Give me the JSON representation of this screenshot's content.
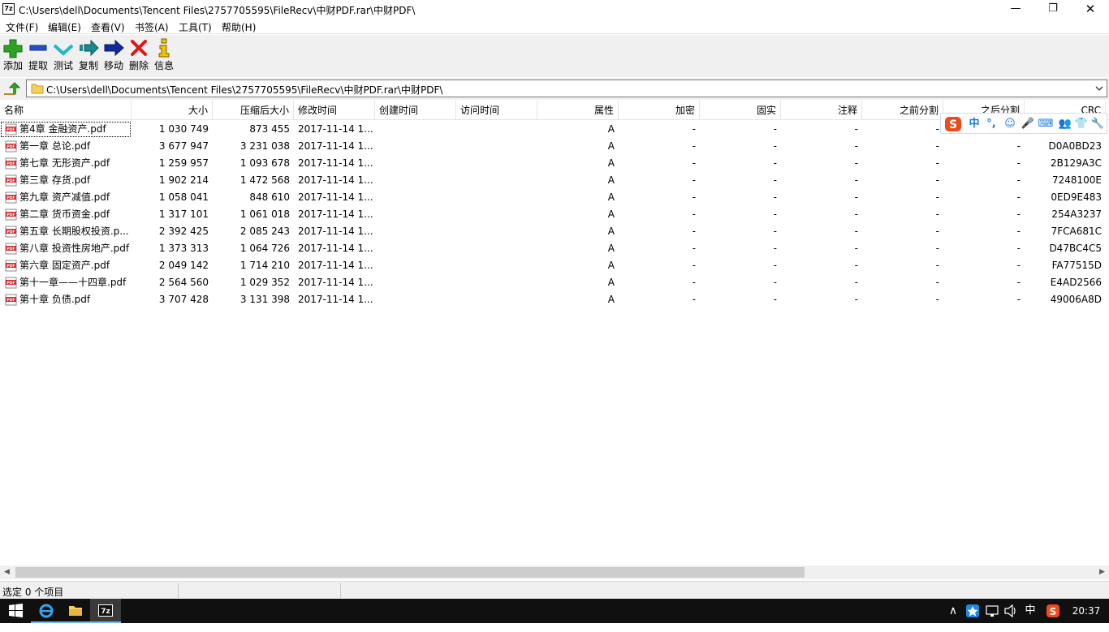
{
  "window": {
    "app_icon_text": "7z",
    "title": "C:\\Users\\dell\\Documents\\Tencent Files\\2757705595\\FileRecv\\中财PDF.rar\\中财PDF\\",
    "minimize": "—",
    "maximize": "❐",
    "close": "✕"
  },
  "menu": {
    "file": "文件(F)",
    "edit": "编辑(E)",
    "view": "查看(V)",
    "bookmarks": "书签(A)",
    "tools": "工具(T)",
    "help": "帮助(H)"
  },
  "toolbar": {
    "add": "添加",
    "extract": "提取",
    "test": "测试",
    "copy": "复制",
    "move": "移动",
    "delete": "删除",
    "info": "信息"
  },
  "address": {
    "path": "C:\\Users\\dell\\Documents\\Tencent Files\\2757705595\\FileRecv\\中财PDF.rar\\中财PDF\\"
  },
  "columns": {
    "name": "名称",
    "size": "大小",
    "packed": "压缩后大小",
    "modified": "修改时间",
    "created": "创建时间",
    "accessed": "访问时间",
    "attributes": "属性",
    "encrypted": "加密",
    "solid": "固实",
    "comment": "注释",
    "split_before": "之前分割",
    "split_after": "之后分割",
    "crc": "CRC"
  },
  "files": [
    {
      "name": "第4章 金融资产.pdf",
      "size": "1 030 749",
      "packed": "873 455",
      "modified": "2017-11-14 1...",
      "attr": "A",
      "enc": "-",
      "solid": "-",
      "comment": "-",
      "before": "-",
      "after": "",
      "crc": ""
    },
    {
      "name": "第一章  总论.pdf",
      "size": "3 677 947",
      "packed": "3 231 038",
      "modified": "2017-11-14 1...",
      "attr": "A",
      "enc": "-",
      "solid": "-",
      "comment": "-",
      "before": "-",
      "after": "-",
      "crc": "D0A0BD23"
    },
    {
      "name": "第七章  无形资产.pdf",
      "size": "1 259 957",
      "packed": "1 093 678",
      "modified": "2017-11-14 1...",
      "attr": "A",
      "enc": "-",
      "solid": "-",
      "comment": "-",
      "before": "-",
      "after": "-",
      "crc": "2B129A3C"
    },
    {
      "name": "第三章  存货.pdf",
      "size": "1 902 214",
      "packed": "1 472 568",
      "modified": "2017-11-14 1...",
      "attr": "A",
      "enc": "-",
      "solid": "-",
      "comment": "-",
      "before": "-",
      "after": "-",
      "crc": "7248100E"
    },
    {
      "name": "第九章    资产减值.pdf",
      "size": "1 058 041",
      "packed": "848 610",
      "modified": "2017-11-14 1...",
      "attr": "A",
      "enc": "-",
      "solid": "-",
      "comment": "-",
      "before": "-",
      "after": "-",
      "crc": "0ED9E483"
    },
    {
      "name": "第二章  货币资金.pdf",
      "size": "1 317 101",
      "packed": "1 061 018",
      "modified": "2017-11-14 1...",
      "attr": "A",
      "enc": "-",
      "solid": "-",
      "comment": "-",
      "before": "-",
      "after": "-",
      "crc": "254A3237"
    },
    {
      "name": "第五章  长期股权投资.p...",
      "size": "2 392 425",
      "packed": "2 085 243",
      "modified": "2017-11-14 1...",
      "attr": "A",
      "enc": "-",
      "solid": "-",
      "comment": "-",
      "before": "-",
      "after": "-",
      "crc": "7FCA681C"
    },
    {
      "name": "第八章 投资性房地产.pdf",
      "size": "1 373 313",
      "packed": "1 064 726",
      "modified": "2017-11-14 1...",
      "attr": "A",
      "enc": "-",
      "solid": "-",
      "comment": "-",
      "before": "-",
      "after": "-",
      "crc": "D47BC4C5"
    },
    {
      "name": "第六章  固定资产.pdf",
      "size": "2 049 142",
      "packed": "1 714 210",
      "modified": "2017-11-14 1...",
      "attr": "A",
      "enc": "-",
      "solid": "-",
      "comment": "-",
      "before": "-",
      "after": "-",
      "crc": "FA77515D"
    },
    {
      "name": "第十一章——十四章.pdf",
      "size": "2 564 560",
      "packed": "1 029 352",
      "modified": "2017-11-14 1...",
      "attr": "A",
      "enc": "-",
      "solid": "-",
      "comment": "-",
      "before": "-",
      "after": "-",
      "crc": "E4AD2566"
    },
    {
      "name": "第十章  负债.pdf",
      "size": "3 707 428",
      "packed": "3 131 398",
      "modified": "2017-11-14 1...",
      "attr": "A",
      "enc": "-",
      "solid": "-",
      "comment": "-",
      "before": "-",
      "after": "-",
      "crc": "49006A8D"
    }
  ],
  "status": {
    "selection": "选定 0 个项目"
  },
  "ime": {
    "logo": "S",
    "mode": "中",
    "punct": "°,",
    "emoji": "☺",
    "voice": "🎤",
    "keyboard": "⌨",
    "user": "👥",
    "skin": "👕",
    "tools": "🔧"
  },
  "taskbar": {
    "tray_up": "∧",
    "lang": "中",
    "clock": "20:37"
  },
  "colors": {
    "pdf_red": "#d8262c",
    "add_green": "#2ea323",
    "extract_blue": "#2550c8",
    "test_cyan": "#23b7c9",
    "copy_teal": "#168a8c",
    "move_navy": "#102a9c",
    "delete_red": "#e01616",
    "info_yellow": "#f2c200",
    "ime_blue": "#1b7ae0",
    "sogou_orange": "#f04a1a"
  }
}
